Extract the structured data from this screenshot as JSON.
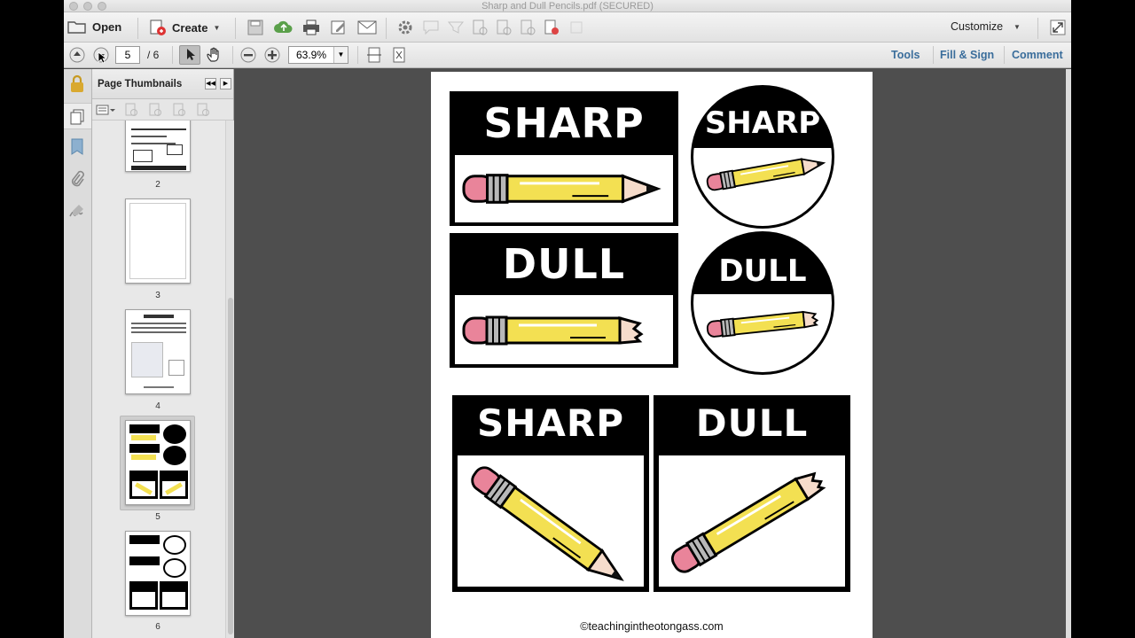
{
  "window": {
    "title": "Sharp and Dull Pencils.pdf (SECURED)"
  },
  "toolbar": {
    "open_label": "Open",
    "create_label": "Create",
    "customize_label": "Customize"
  },
  "nav": {
    "page_current": "5",
    "page_total": "/ 6",
    "zoom": "63.9%"
  },
  "right_tabs": {
    "tools": "Tools",
    "fill_sign": "Fill & Sign",
    "comment": "Comment"
  },
  "sidebar": {
    "title": "Page Thumbnails",
    "thumbnails": [
      {
        "number": "2"
      },
      {
        "number": "3"
      },
      {
        "number": "4"
      },
      {
        "number": "5",
        "selected": true
      },
      {
        "number": "6"
      }
    ]
  },
  "document": {
    "labels": {
      "sharp": "SHARP",
      "dull": "DULL"
    },
    "copyright": "©teachingintheotongass.com"
  },
  "colors": {
    "link_blue": "#3a6d9b",
    "pencil_yellow": "#f3e052",
    "eraser_pink": "#e9849a"
  },
  "icons": [
    "folder-icon",
    "create-icon",
    "save-icon",
    "upload-icon",
    "print-icon",
    "edit-icon",
    "mail-icon",
    "gear-icon",
    "comment-icon",
    "stamp-icon",
    "up-arrow-icon",
    "down-arrow-icon",
    "select-arrow-icon",
    "hand-icon",
    "zoom-out-icon",
    "zoom-in-icon",
    "fit-page-icon",
    "fit-width-icon",
    "lock-icon",
    "page-icon",
    "bookmark-icon",
    "attachment-icon",
    "signature-icon"
  ]
}
